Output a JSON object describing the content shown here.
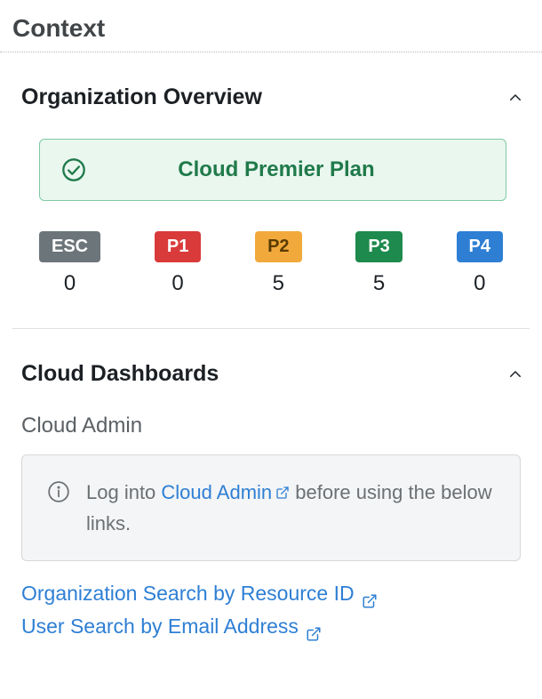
{
  "header": {
    "title": "Context"
  },
  "org_overview": {
    "title": "Organization Overview",
    "plan_label": "Cloud Premier Plan",
    "priorities": [
      {
        "label": "ESC",
        "count": "0",
        "badge_class": "badge-esc"
      },
      {
        "label": "P1",
        "count": "0",
        "badge_class": "badge-p1"
      },
      {
        "label": "P2",
        "count": "5",
        "badge_class": "badge-p2"
      },
      {
        "label": "P3",
        "count": "5",
        "badge_class": "badge-p3"
      },
      {
        "label": "P4",
        "count": "0",
        "badge_class": "badge-p4"
      }
    ]
  },
  "dashboards": {
    "title": "Cloud Dashboards",
    "subsection": "Cloud Admin",
    "info_prefix": "Log into ",
    "info_link_text": "Cloud Admin",
    "info_suffix": " before using the below links.",
    "links": [
      {
        "text": "Organization Search by Resource ID"
      },
      {
        "text": "User Search by Email Address"
      }
    ]
  }
}
